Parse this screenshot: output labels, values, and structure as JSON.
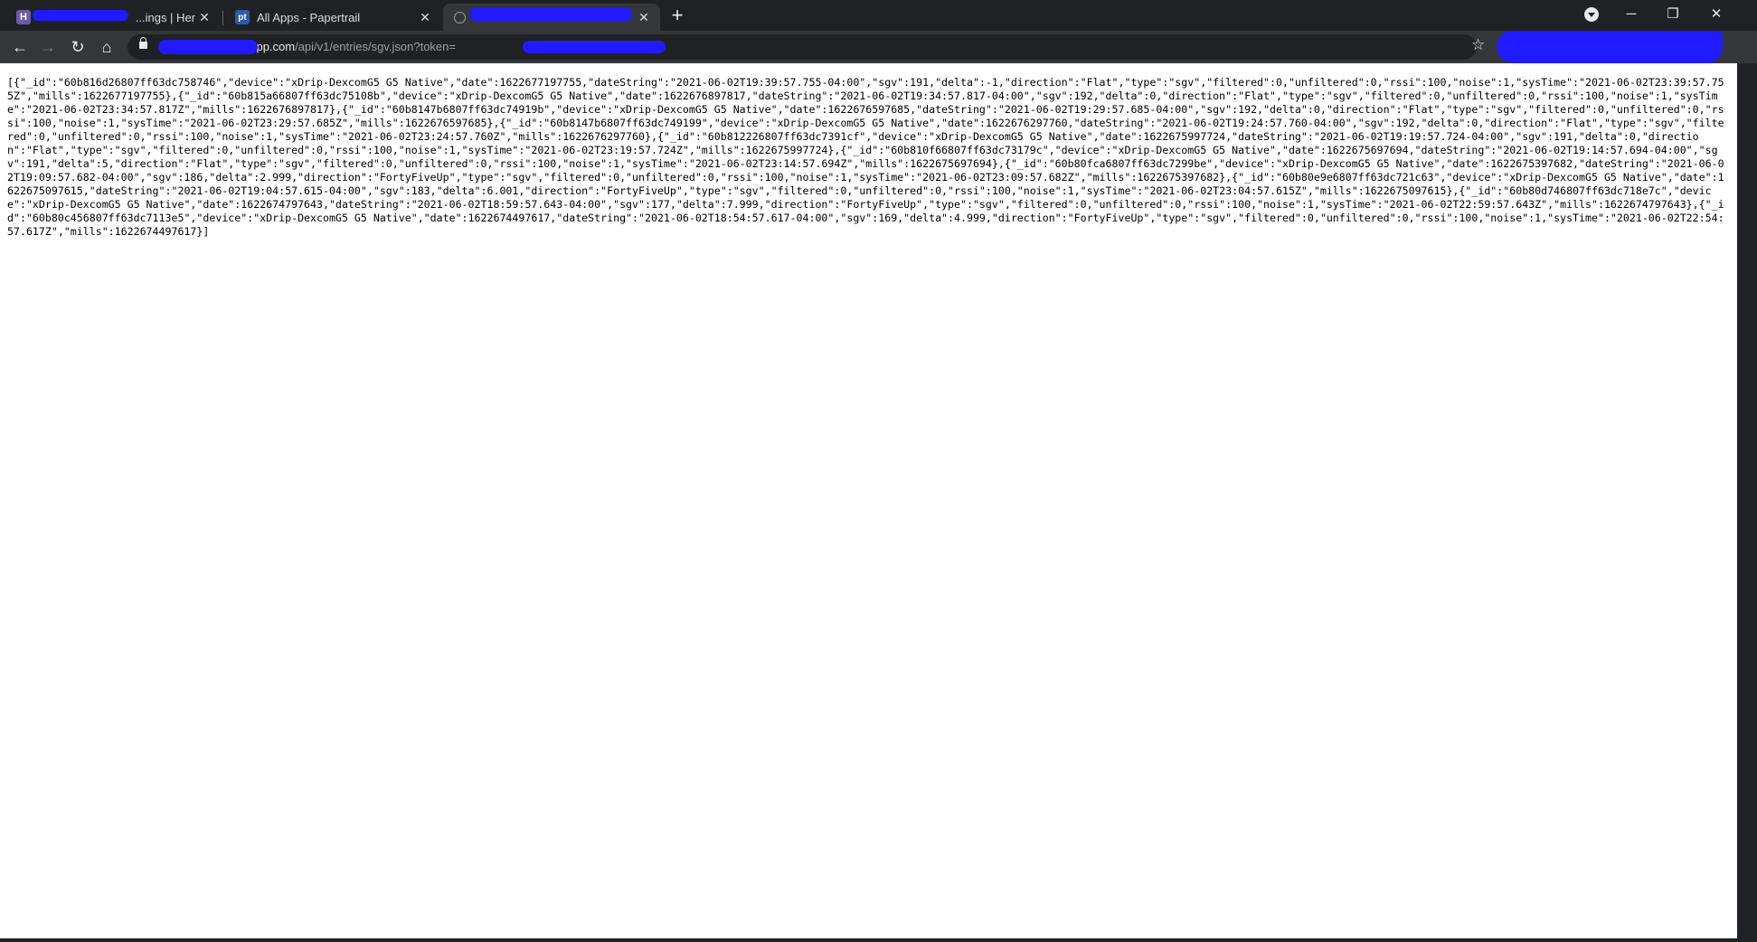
{
  "browser": {
    "tabs": [
      {
        "favicon": "H",
        "title": "...ings | Her",
        "close": "✕"
      },
      {
        "favicon": "pt",
        "title": "All Apps - Papertrail",
        "close": "✕"
      },
      {
        "favicon": "",
        "title": "",
        "close": "✕"
      }
    ],
    "new_tab": "+",
    "window_controls": {
      "minimize": "─",
      "restore": "❐",
      "close": "✕"
    },
    "nav": {
      "back": "←",
      "forward": "→",
      "reload": "↻",
      "home": "⌂",
      "star": "☆"
    },
    "address_bar": {
      "host_visible": "uapp.com",
      "path": "/api/v1/entries/sgv.json?token="
    },
    "icons": [
      "h-favicon-icon",
      "papertrail-favicon-icon",
      "globe-icon",
      "close-icon",
      "plus-icon",
      "tab-search-icon",
      "minimize-icon",
      "restore-icon",
      "back-icon",
      "forward-icon",
      "reload-icon",
      "home-icon",
      "lock-icon",
      "star-icon"
    ]
  },
  "colors": {
    "tabstrip": "#202124",
    "toolbar": "#35363a",
    "redaction": "#1f1aff",
    "page_bg": "#ffffff"
  },
  "page": {
    "json": "[{\"_id\":\"60b816d26807ff63dc758746\",\"device\":\"xDrip-DexcomG5 G5 Native\",\"date\":1622677197755,\"dateString\":\"2021-06-02T19:39:57.755-04:00\",\"sgv\":191,\"delta\":-1,\"direction\":\"Flat\",\"type\":\"sgv\",\"filtered\":0,\"unfiltered\":0,\"rssi\":100,\"noise\":1,\"sysTime\":\"2021-06-02T23:39:57.755Z\",\"mills\":1622677197755},{\"_id\":\"60b815a66807ff63dc75108b\",\"device\":\"xDrip-DexcomG5 G5 Native\",\"date\":1622676897817,\"dateString\":\"2021-06-02T19:34:57.817-04:00\",\"sgv\":192,\"delta\":0,\"direction\":\"Flat\",\"type\":\"sgv\",\"filtered\":0,\"unfiltered\":0,\"rssi\":100,\"noise\":1,\"sysTime\":\"2021-06-02T23:34:57.817Z\",\"mills\":1622676897817},{\"_id\":\"60b8147b6807ff63dc74919b\",\"device\":\"xDrip-DexcomG5 G5 Native\",\"date\":1622676597685,\"dateString\":\"2021-06-02T19:29:57.685-04:00\",\"sgv\":192,\"delta\":0,\"direction\":\"Flat\",\"type\":\"sgv\",\"filtered\":0,\"unfiltered\":0,\"rssi\":100,\"noise\":1,\"sysTime\":\"2021-06-02T23:29:57.685Z\",\"mills\":1622676597685},{\"_id\":\"60b8147b6807ff63dc749199\",\"device\":\"xDrip-DexcomG5 G5 Native\",\"date\":1622676297760,\"dateString\":\"2021-06-02T19:24:57.760-04:00\",\"sgv\":192,\"delta\":0,\"direction\":\"Flat\",\"type\":\"sgv\",\"filtered\":0,\"unfiltered\":0,\"rssi\":100,\"noise\":1,\"sysTime\":\"2021-06-02T23:24:57.760Z\",\"mills\":1622676297760},{\"_id\":\"60b812226807ff63dc7391cf\",\"device\":\"xDrip-DexcomG5 G5 Native\",\"date\":1622675997724,\"dateString\":\"2021-06-02T19:19:57.724-04:00\",\"sgv\":191,\"delta\":0,\"direction\":\"Flat\",\"type\":\"sgv\",\"filtered\":0,\"unfiltered\":0,\"rssi\":100,\"noise\":1,\"sysTime\":\"2021-06-02T23:19:57.724Z\",\"mills\":1622675997724},{\"_id\":\"60b810f66807ff63dc73179c\",\"device\":\"xDrip-DexcomG5 G5 Native\",\"date\":1622675697694,\"dateString\":\"2021-06-02T19:14:57.694-04:00\",\"sgv\":191,\"delta\":5,\"direction\":\"Flat\",\"type\":\"sgv\",\"filtered\":0,\"unfiltered\":0,\"rssi\":100,\"noise\":1,\"sysTime\":\"2021-06-02T23:14:57.694Z\",\"mills\":1622675697694},{\"_id\":\"60b80fca6807ff63dc7299be\",\"device\":\"xDrip-DexcomG5 G5 Native\",\"date\":1622675397682,\"dateString\":\"2021-06-02T19:09:57.682-04:00\",\"sgv\":186,\"delta\":2.999,\"direction\":\"FortyFiveUp\",\"type\":\"sgv\",\"filtered\":0,\"unfiltered\":0,\"rssi\":100,\"noise\":1,\"sysTime\":\"2021-06-02T23:09:57.682Z\",\"mills\":1622675397682},{\"_id\":\"60b80e9e6807ff63dc721c63\",\"device\":\"xDrip-DexcomG5 G5 Native\",\"date\":1622675097615,\"dateString\":\"2021-06-02T19:04:57.615-04:00\",\"sgv\":183,\"delta\":6.001,\"direction\":\"FortyFiveUp\",\"type\":\"sgv\",\"filtered\":0,\"unfiltered\":0,\"rssi\":100,\"noise\":1,\"sysTime\":\"2021-06-02T23:04:57.615Z\",\"mills\":1622675097615},{\"_id\":\"60b80d746807ff63dc718e7c\",\"device\":\"xDrip-DexcomG5 G5 Native\",\"date\":1622674797643,\"dateString\":\"2021-06-02T18:59:57.643-04:00\",\"sgv\":177,\"delta\":7.999,\"direction\":\"FortyFiveUp\",\"type\":\"sgv\",\"filtered\":0,\"unfiltered\":0,\"rssi\":100,\"noise\":1,\"sysTime\":\"2021-06-02T22:59:57.643Z\",\"mills\":1622674797643},{\"_id\":\"60b80c456807ff63dc7113e5\",\"device\":\"xDrip-DexcomG5 G5 Native\",\"date\":1622674497617,\"dateString\":\"2021-06-02T18:54:57.617-04:00\",\"sgv\":169,\"delta\":4.999,\"direction\":\"FortyFiveUp\",\"type\":\"sgv\",\"filtered\":0,\"unfiltered\":0,\"rssi\":100,\"noise\":1,\"sysTime\":\"2021-06-02T22:54:57.617Z\",\"mills\":1622674497617}]"
  }
}
